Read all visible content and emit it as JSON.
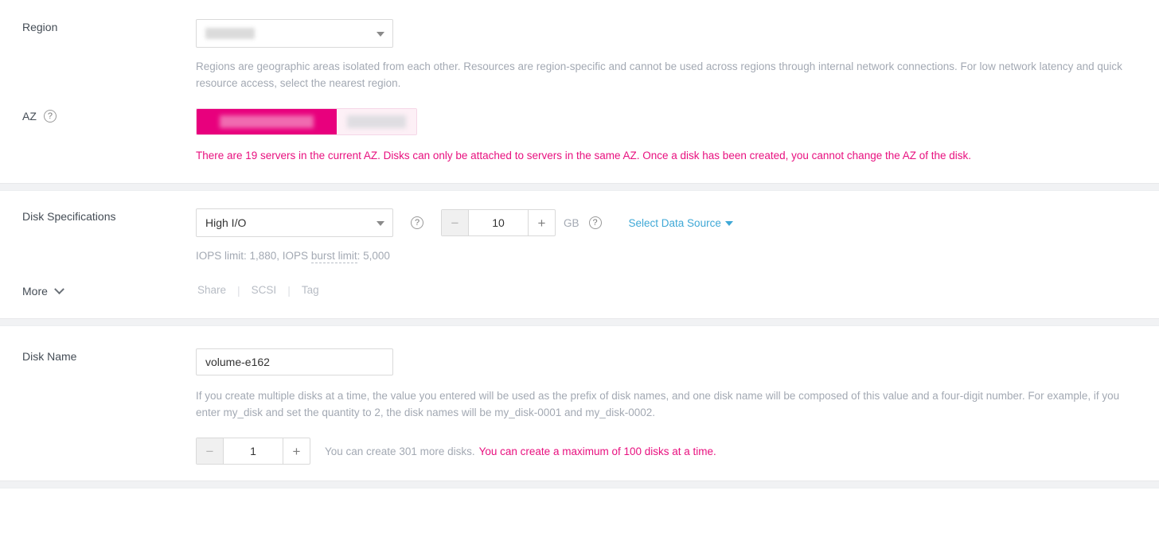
{
  "form": {
    "region": {
      "label": "Region",
      "selected_value_redacted": true,
      "caret_icon": "chevron-down-icon",
      "hint": "Regions are geographic areas isolated from each other. Resources are region-specific and cannot be used across regions through internal network connections. For low network latency and quick resource access, select the nearest region."
    },
    "az": {
      "label": "AZ",
      "help_icon": "question-mark-icon",
      "options": [
        {
          "label_redacted": true,
          "selected": true
        },
        {
          "label_redacted": true,
          "selected": false
        }
      ],
      "warning": "There are 19 servers in the current AZ. Disks can only be attached to servers in the same AZ. Once a disk has been created, you cannot change the AZ of the disk.",
      "selected_color": "#e8007d",
      "unselected_color": "#fdf0f6"
    },
    "disk_specifications": {
      "label": "Disk Specifications",
      "selected": "High I/O",
      "caret_icon": "chevron-down-icon",
      "help_icon": "question-mark-icon",
      "size": {
        "minus_label": "−",
        "value": "10",
        "plus_label": "+",
        "unit": "GB",
        "help_icon": "question-mark-icon"
      },
      "data_source_link": "Select Data Source",
      "data_source_caret_icon": "chevron-down-icon",
      "iops_text_prefix": "IOPS limit: 1,880, IOPS ",
      "iops_term": "burst limit",
      "iops_text_suffix": ": 5,000"
    },
    "more": {
      "label": "More",
      "chevron_icon": "chevron-down-icon",
      "links": [
        "Share",
        "SCSI",
        "Tag"
      ],
      "separator": "|"
    },
    "disk_name": {
      "label": "Disk Name",
      "value": "volume-e162",
      "placeholder": "",
      "hint": "If you create multiple disks at a time, the value you entered will be used as the prefix of disk names, and one disk name will be composed of this value and a four-digit number. For example, if you enter my_disk and set the quantity to 2, the disk names will be my_disk-0001 and my_disk-0002.",
      "quantity": {
        "minus_label": "−",
        "value": "1",
        "plus_label": "+"
      },
      "quantity_hint": "You can create 301 more disks.",
      "quantity_warning": "You can create a maximum of 100 disks at a time."
    }
  },
  "colors": {
    "accent_magenta": "#e8007d",
    "link_blue": "#3fa8d6",
    "hint_gray": "#a3a9b3",
    "divider_gray": "#f1f2f4"
  }
}
